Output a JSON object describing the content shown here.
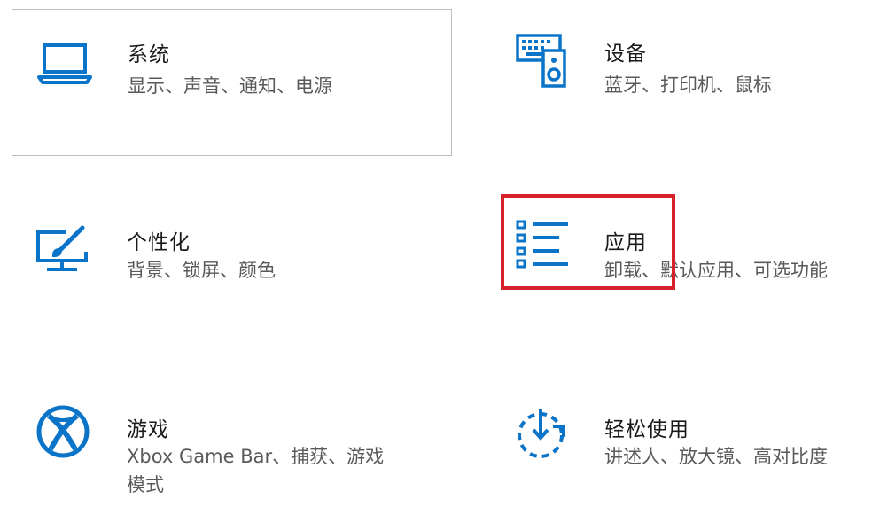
{
  "accent_color": "#0a74c9",
  "highlight_color": "#d6222a",
  "tiles": [
    {
      "key": "system",
      "title": "系统",
      "desc": "显示、声音、通知、电源",
      "icon": "laptop-icon"
    },
    {
      "key": "devices",
      "title": "设备",
      "desc": "蓝牙、打印机、鼠标",
      "icon": "keyboard-speaker-icon"
    },
    {
      "key": "personalization",
      "title": "个性化",
      "desc": "背景、锁屏、颜色",
      "icon": "paint-screen-icon"
    },
    {
      "key": "apps",
      "title": "应用",
      "desc": "卸载、默认应用、可选功能",
      "icon": "app-list-icon"
    },
    {
      "key": "gaming",
      "title": "游戏",
      "desc_line1": "Xbox Game Bar、捕获、游戏",
      "desc_line2": "模式",
      "icon": "xbox-icon"
    },
    {
      "key": "ease_of_access",
      "title": "轻松使用",
      "desc": "讲述人、放大镜、高对比度",
      "icon": "ease-of-access-icon"
    }
  ]
}
